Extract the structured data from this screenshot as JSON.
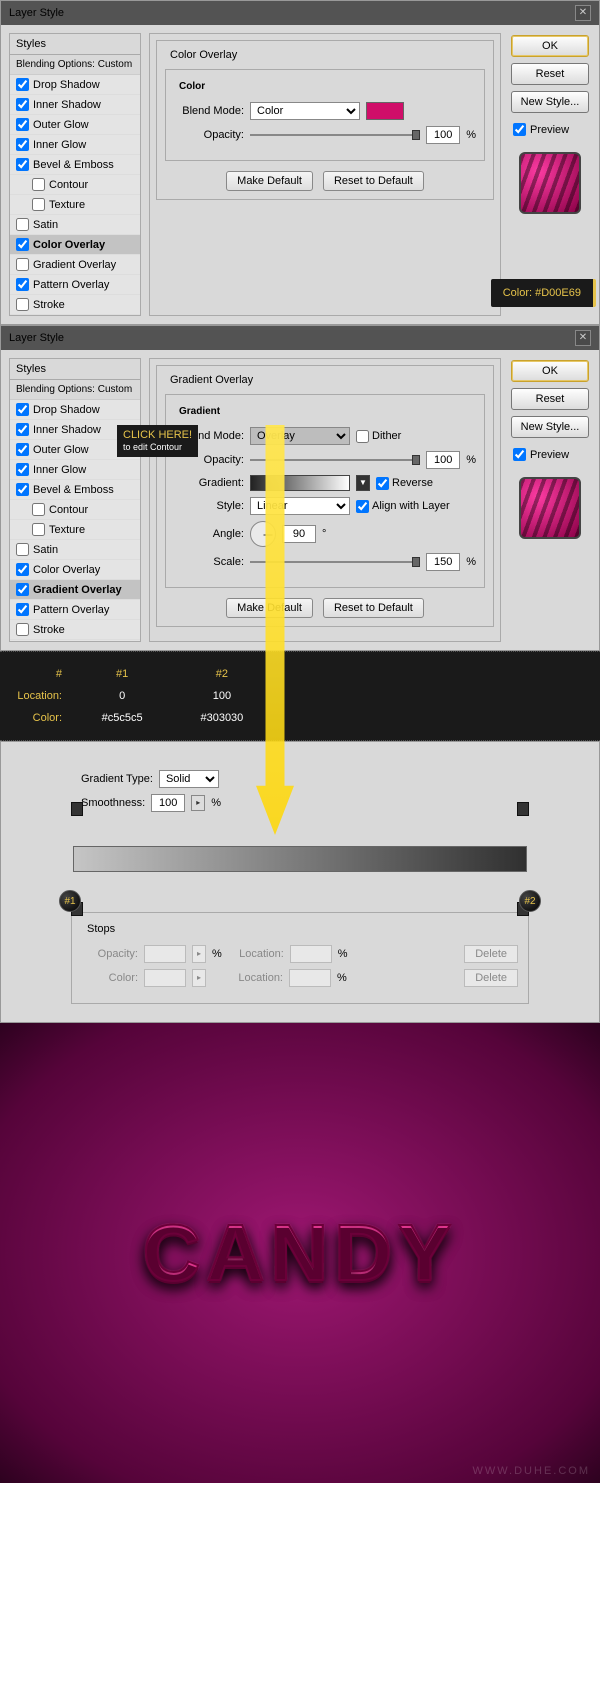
{
  "dlg1": {
    "title": "Layer Style",
    "styles_header": "Styles",
    "blending": "Blending Options: Custom",
    "items": [
      {
        "label": "Drop Shadow",
        "checked": true
      },
      {
        "label": "Inner Shadow",
        "checked": true
      },
      {
        "label": "Outer Glow",
        "checked": true
      },
      {
        "label": "Inner Glow",
        "checked": true
      },
      {
        "label": "Bevel & Emboss",
        "checked": true
      },
      {
        "label": "Contour",
        "checked": false,
        "indent": true
      },
      {
        "label": "Texture",
        "checked": false,
        "indent": true
      },
      {
        "label": "Satin",
        "checked": false
      },
      {
        "label": "Color Overlay",
        "checked": true,
        "selected": true
      },
      {
        "label": "Gradient Overlay",
        "checked": false
      },
      {
        "label": "Pattern Overlay",
        "checked": true
      },
      {
        "label": "Stroke",
        "checked": false
      }
    ],
    "panel_title": "Color Overlay",
    "sub_title": "Color",
    "blend_label": "Blend Mode:",
    "blend_value": "Color",
    "opacity_label": "Opacity:",
    "opacity_value": "100",
    "pct": "%",
    "make_default": "Make Default",
    "reset_default": "Reset to Default",
    "ok": "OK",
    "reset": "Reset",
    "newstyle": "New Style...",
    "preview": "Preview",
    "color_tip": "Color: #D00E69"
  },
  "dlg2": {
    "title": "Layer Style",
    "styles_header": "Styles",
    "blending": "Blending Options: Custom",
    "items": [
      {
        "label": "Drop Shadow",
        "checked": true
      },
      {
        "label": "Inner Shadow",
        "checked": true
      },
      {
        "label": "Outer Glow",
        "checked": true
      },
      {
        "label": "Inner Glow",
        "checked": true
      },
      {
        "label": "Bevel & Emboss",
        "checked": true
      },
      {
        "label": "Contour",
        "checked": false,
        "indent": true
      },
      {
        "label": "Texture",
        "checked": false,
        "indent": true
      },
      {
        "label": "Satin",
        "checked": false
      },
      {
        "label": "Color Overlay",
        "checked": true
      },
      {
        "label": "Gradient Overlay",
        "checked": true,
        "selected": true
      },
      {
        "label": "Pattern Overlay",
        "checked": true
      },
      {
        "label": "Stroke",
        "checked": false
      }
    ],
    "panel_title": "Gradient Overlay",
    "sub_title": "Gradient",
    "blend_label": "Blend Mode:",
    "blend_value": "Overlay",
    "dither": "Dither",
    "opacity_label": "Opacity:",
    "opacity_value": "100",
    "pct": "%",
    "gradient_label": "Gradient:",
    "reverse": "Reverse",
    "style_label": "Style:",
    "style_value": "Linear",
    "align": "Align with Layer",
    "angle_label": "Angle:",
    "angle_value": "90",
    "deg": "°",
    "scale_label": "Scale:",
    "scale_value": "150",
    "make_default": "Make Default",
    "reset_default": "Reset to Default",
    "ok": "OK",
    "reset": "Reset",
    "newstyle": "New Style...",
    "preview": "Preview",
    "hint_line1": "CLICK HERE!",
    "hint_line2": "to edit Contour"
  },
  "stops_table": {
    "h_num": "#",
    "h1": "#1",
    "h2": "#2",
    "loc": "Location:",
    "loc1": "0",
    "loc2": "100",
    "col": "Color:",
    "col1": "#c5c5c5",
    "col2": "#303030"
  },
  "grad": {
    "type_label": "Gradient Type:",
    "type_value": "Solid",
    "smooth_label": "Smoothness:",
    "smooth_value": "100",
    "pct": "%",
    "stops": "Stops",
    "opacity": "Opacity:",
    "location": "Location:",
    "color": "Color:",
    "delete": "Delete",
    "b1": "#1",
    "b2": "#2"
  },
  "result": {
    "text": "CANDY",
    "watermark": "WWW.DUHE.COM"
  }
}
